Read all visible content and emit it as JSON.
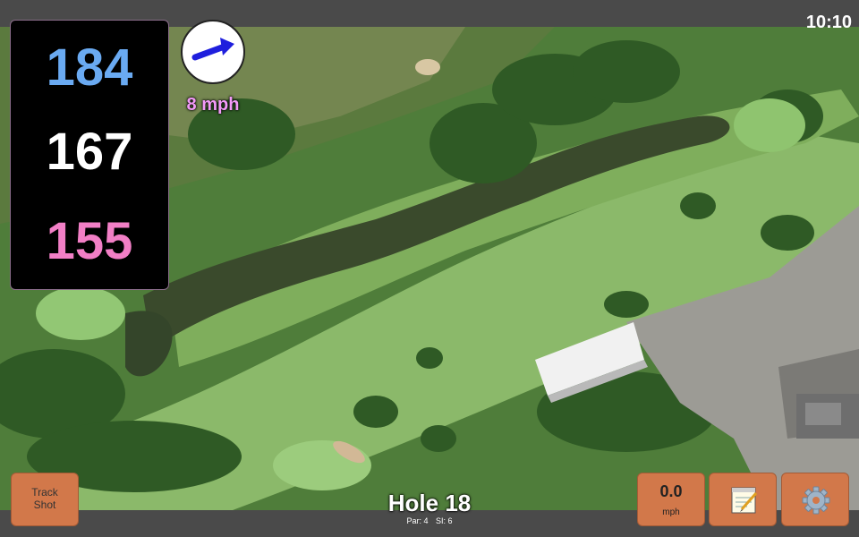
{
  "status": {
    "time": "10:10"
  },
  "distances": {
    "back": "184",
    "middle": "167",
    "front": "155"
  },
  "wind": {
    "speed_text": "8 mph",
    "direction_icon": "arrow-icon"
  },
  "buttons": {
    "track_shot": "Track Shot",
    "wind_value": "0.0",
    "wind_unit": "mph",
    "notes_icon": "notepad-icon",
    "settings_icon": "gear-icon"
  },
  "hole": {
    "title": "Hole 18",
    "par": "Par: 4",
    "si": "SI: 6"
  },
  "colors": {
    "back": "#6aaaf2",
    "middle": "#ffffff",
    "front": "#f27fc6",
    "wind_text": "#f39af8",
    "button": "#d2784a"
  }
}
